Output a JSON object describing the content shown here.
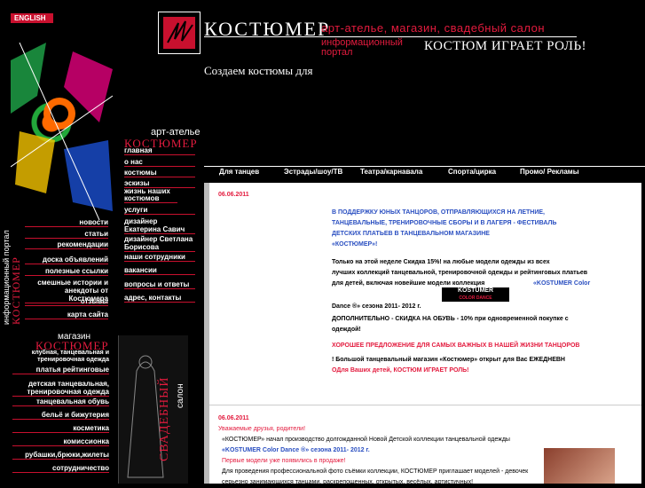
{
  "header": {
    "english_label": "ENGLISH",
    "brand": "КОСТЮМЕР",
    "tagline_red_1": "арт-ателье, магазин, свадебный салон",
    "tagline_red_2": "информационный портал",
    "slogan": "КОСТЮМ ИГРАЕТ РОЛЬ!",
    "subtitle": "Создаем костюмы для"
  },
  "atelier": {
    "label": "арт-ателье",
    "brand": "КОСТЮМЕР",
    "items": [
      "главная",
      "о нас",
      "костюмы",
      "эскизы",
      "жизнь наших костюмов",
      "услуги",
      "дизайнер Екатерина Савич",
      "дизайнер Светлана Борисова",
      "наши сотрудники",
      "вакансии",
      "вопросы и ответы",
      "адрес, контакты"
    ]
  },
  "portal": {
    "label": "информационный портал",
    "brand": "КОСТЮМЕР",
    "items": [
      "новости",
      "статьи",
      "рекомендации",
      "доска объявлений",
      "полезные ссылки",
      "смешные истории и анекдоты от Костюмера",
      "отзывы",
      "карта сайта"
    ]
  },
  "shop": {
    "label": "магазин",
    "brand": "КОСТЮМЕР",
    "heading": "клубная, танцевальная и тренировочная одежда",
    "items": [
      "платья рейтинговые",
      "детская танцевальная, тренировочная одежда",
      "танцевальная обувь",
      "бельё и бижутерия",
      "косметика",
      "комиссионка",
      "рубашки,брюки,жилеты",
      "сотрудничество"
    ]
  },
  "salon": {
    "label": "салон",
    "brand": "СВАДЕБНЫЙ"
  },
  "tabs": [
    "Для танцев",
    "Эстрады/шоу/ТВ",
    "Театра/карнавала",
    "Спорта/цирка",
    "Промо/ Рекламы"
  ],
  "news1": {
    "date": "06.06.2011",
    "headline_1": "В ПОДДЕРЖКУ ЮНЫХ ТАНЦОРОВ, ОТПРАВЛЯЮЩИХСЯ НА ЛЕТНИЕ,",
    "headline_2": "ТАНЦЕВАЛЬНЫЕ, ТРЕНИРОВОЧНЫЕ СБОРЫ И В ЛАГЕРЯ - ФЕСТИВАЛЬ",
    "headline_3": "ДЕТСКИХ ПЛАТЬЕВ В ТАНЦЕВАЛЬНОМ МАГАЗИНЕ",
    "headline_4": "«КОСТЮМЕР»!",
    "p1": "Только на этой  неделе Скидка 15%!  на  любые модели одежды  из всех",
    "p2": "лучших коллекций  танцевальной, тренировочной одежды и рейтинговых платьев",
    "p3": "для детей, включая новейшие модели  коллекция",
    "p3_link": "«KOSTUMER Color",
    "badge": "KOSTUMER",
    "badge_sub": "COLOR DANCE",
    "p4": "Dance ®» сезона 2011- 2012 г.",
    "p5": "ДОПОЛНИТЕЛЬНО - СКИДКА НА ОБУВЬ - 10% при одновременной покупке с",
    "p6": "одеждой!",
    "p7": "ХОРОШЕЕ ПРЕДЛОЖЕНИЕ ДЛЯ САМЫХ ВАЖНЫХ В НАШЕЙ ЖИЗНИ ТАНЦОРОВ",
    "p8": "!   Большой танцевальный магазин «Костюмер» открыт для Вас ЕЖЕДНЕВН",
    "p9": "ОДля Ваших детей, КОСТЮМ ИГРАЕТ РОЛЬ!"
  },
  "news2": {
    "date": "06.06.2011",
    "greeting": "Уважаемые друзья, родители!",
    "p1": "«КОСТЮМЕР» начал производство долгожданной Новой Детской коллекции танцевальной одежды",
    "p2": "«KOSTUMER Color Dance ®» сезона 2011- 2012 г.",
    "p3": "Первые модели уже появились в продаже!",
    "p4": "Для проведения профессиональной фото съёмки коллекции, КОСТЮМЕР приглашает моделей - девочек",
    "p5": "серьезно занимающихся танцами, раскрепощенных, открытых, весёлых, артистичных!"
  }
}
